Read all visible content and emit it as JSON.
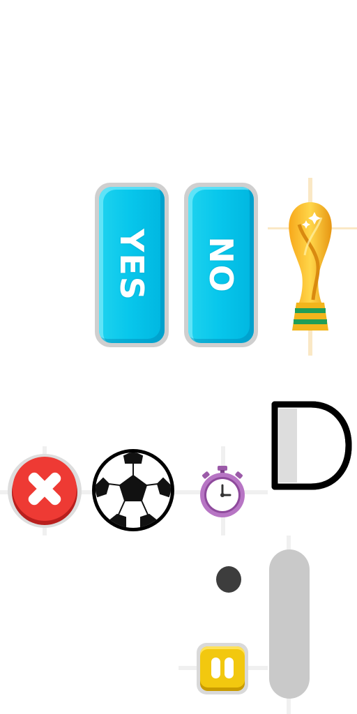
{
  "answers": {
    "yes_label": "YES",
    "no_label": "NO"
  },
  "icons": {
    "trophy": "trophy-icon",
    "close": "close-x-icon",
    "ball": "soccer-ball-icon",
    "timer": "stopwatch-icon",
    "letter_d": "letter-d-outline-icon",
    "pause": "pause-icon"
  },
  "colors": {
    "answer_button": "#08c7ec",
    "close_button": "#e8322f",
    "pause_button": "#f2c80f",
    "slider_track": "#c9c9c9",
    "slider_knob": "#3d3d3d",
    "trophy_gold": "#f2b51c",
    "trophy_green": "#1f9e57",
    "stopwatch_purple": "#9b5aa8"
  }
}
